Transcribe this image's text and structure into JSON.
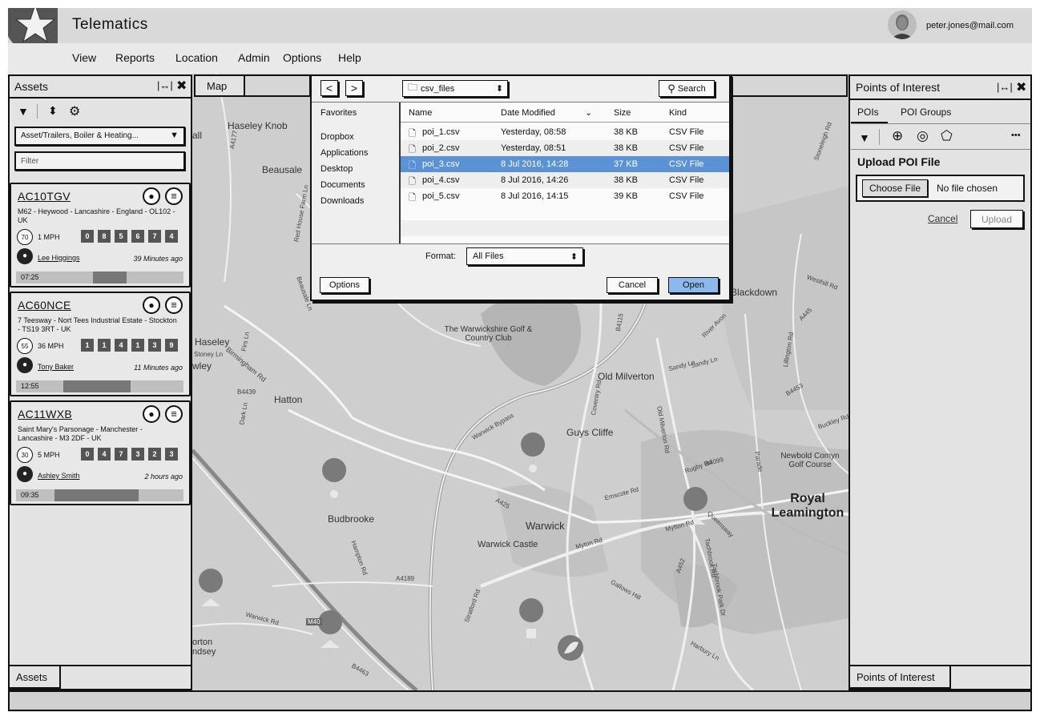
{
  "app": {
    "title": "Telematics",
    "user_email": "peter.jones@mail.com"
  },
  "menu": [
    "View",
    "Reports",
    "Location",
    "Admin",
    "Options",
    "Help"
  ],
  "assets_panel": {
    "title": "Assets",
    "group_select": "Asset/Trailers, Boiler & Heating...",
    "filter_placeholder": "Filter",
    "footer_tab": "Assets",
    "cards": [
      {
        "plate": "AC10TGV",
        "address": "M62 - Heywood - Lancashire - England - OL102 - UK",
        "speed_limit": "70",
        "speed": "1 MPH",
        "odometer": [
          "0",
          "8",
          "5",
          "6",
          "7",
          "4"
        ],
        "driver": "Lee Higgings",
        "ago": "39 Minutes ago",
        "time": "07:25",
        "progress": 0.2
      },
      {
        "plate": "AC60NCE",
        "address": "7 Teesway - Nort Tees Industrial Estate - Stockton - TS19 3RT - UK",
        "speed_limit": "55",
        "speed": "36 MPH",
        "odometer": [
          "1",
          "1",
          "4",
          "1",
          "3",
          "9"
        ],
        "driver": "Tony Baker",
        "ago": "11 Minutes ago",
        "time": "12:55",
        "progress": 0.4
      },
      {
        "plate": "AC11WXB",
        "address": "Saint Mary's Parsonage - Manchester - Lancashire - M3 2DF - UK",
        "speed_limit": "30",
        "speed": "5 MPH",
        "odometer": [
          "0",
          "4",
          "7",
          "3",
          "2",
          "3"
        ],
        "driver": "Ashley Smith",
        "ago": "2 hours ago",
        "time": "09:35",
        "progress": 0.5
      }
    ]
  },
  "map": {
    "tab_label": "Map",
    "places": [
      "Haseley Knob",
      "Beausale",
      "Haseley",
      "Hatton",
      "The Warwickshire Golf & Country Club",
      "Old Milverton",
      "Blackdown",
      "Guys Cliffe",
      "Budbrooke",
      "Warwick",
      "Warwick Castle",
      "Royal Leamington",
      "Newbold Comyn Golf Course",
      "orton ndsey",
      "all",
      "wley"
    ],
    "roads": [
      "A4177",
      "Red House Farm Ln",
      "Beausale Ln",
      "Birmingham Rd",
      "B4439",
      "Dark Ln",
      "Warwick Bypass",
      "Coventry Rd",
      "B4115",
      "A425",
      "Emscote Rd",
      "Rugby Rd",
      "B4099",
      "A452",
      "Mytton Rd",
      "Myton Rd",
      "Gallows Hill",
      "A4189",
      "Hampton Rd",
      "Warwick Rd",
      "M40",
      "B4463",
      "Stratford Rd",
      "Harbury Ln",
      "Tachbrook Rd",
      "Queensway",
      "Sandy Ln",
      "River Avon",
      "Lillington Rd",
      "B4453",
      "Westhill Rd",
      "A445",
      "Parade",
      "Buckley Rd",
      "Stoneleigh Rd",
      "Firs Ln",
      "Stoney Ln",
      "Old Milverton Rd",
      "Tachbrook Park Dr",
      "Sandy Ln"
    ]
  },
  "file_dialog": {
    "folder": "csv_files",
    "search_label": "Search",
    "favorites_label": "Favorites",
    "favorites": [
      "Dropbox",
      "Applications",
      "Desktop",
      "Documents",
      "Downloads"
    ],
    "columns": {
      "name": "Name",
      "date": "Date Modified",
      "size": "Size",
      "kind": "Kind"
    },
    "files": [
      {
        "name": "poi_1.csv",
        "date": "Yesterday, 08:58",
        "size": "38 KB",
        "kind": "CSV File",
        "selected": false
      },
      {
        "name": "poi_2.csv",
        "date": "Yesterday, 08:51",
        "size": "38 KB",
        "kind": "CSV File",
        "selected": false
      },
      {
        "name": "poi_3.csv",
        "date": "8 Jul 2016, 14:28",
        "size": "37 KB",
        "kind": "CSV File",
        "selected": true
      },
      {
        "name": "poi_4.csv",
        "date": "8 Jul 2016, 14:26",
        "size": "38 KB",
        "kind": "CSV File",
        "selected": false
      },
      {
        "name": "poi_5.csv",
        "date": "8 Jul 2016, 14:15",
        "size": "39 KB",
        "kind": "CSV File",
        "selected": false
      }
    ],
    "format_label": "Format:",
    "format_value": "All Files",
    "options_button": "Options",
    "cancel_button": "Cancel",
    "open_button": "Open"
  },
  "poi_panel": {
    "title": "Points of Interest",
    "tabs": [
      "POIs",
      "POI Groups"
    ],
    "more": "•••",
    "upload_title": "Upload POI File",
    "choose_file": "Choose File",
    "no_file": "No file chosen",
    "cancel": "Cancel",
    "upload": "Upload",
    "footer_tab": "Points of Interest"
  },
  "colors": {
    "selection": "#5b92d6",
    "open_button": "#8db8ee"
  }
}
